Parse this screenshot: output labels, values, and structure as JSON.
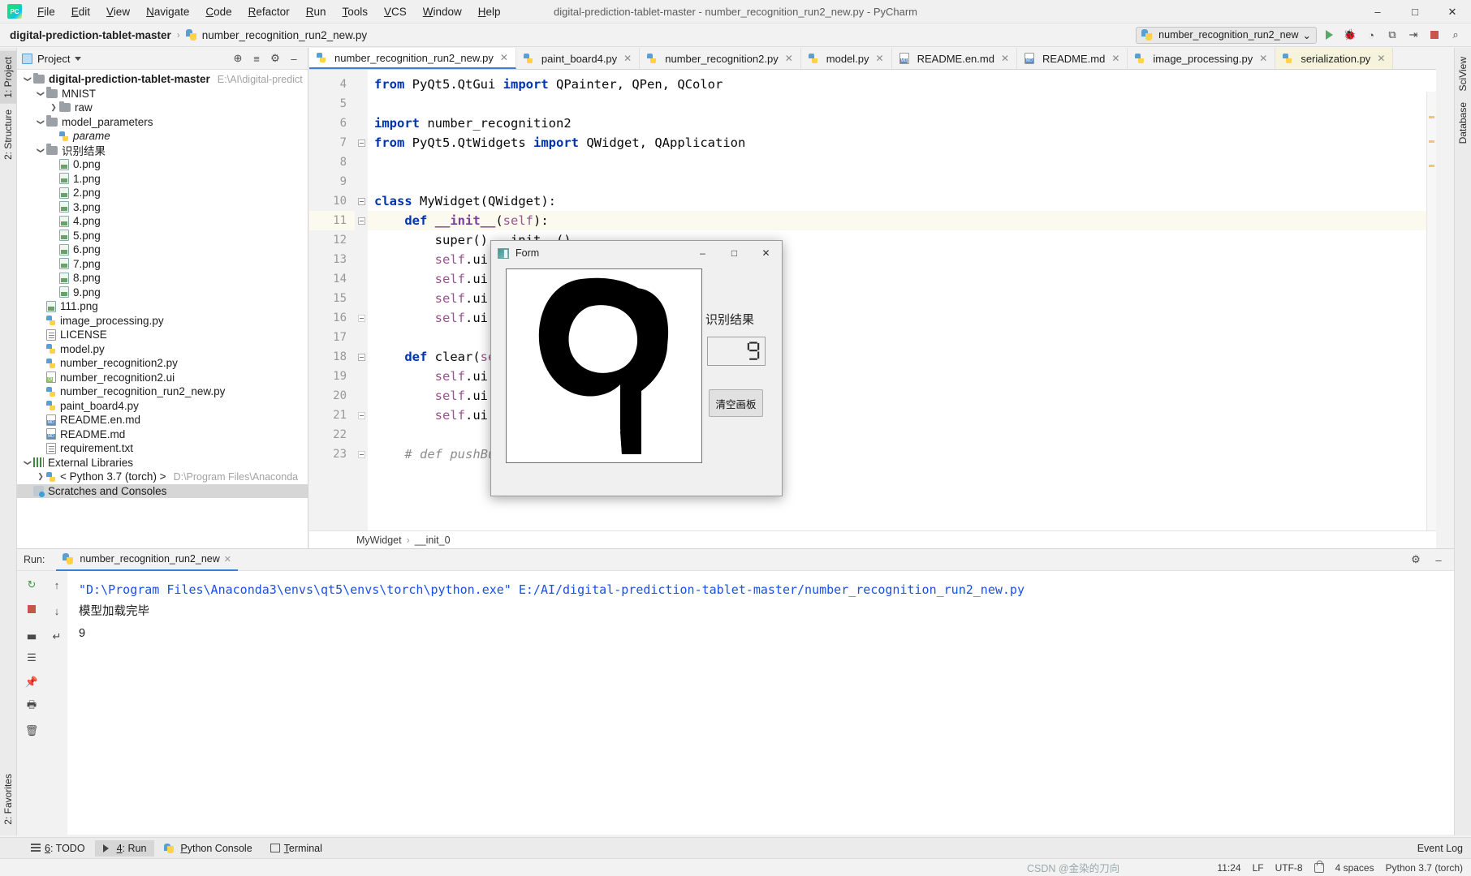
{
  "titlebar": {
    "window_title": "digital-prediction-tablet-master - number_recognition_run2_new.py - PyCharm",
    "menus": [
      "File",
      "Edit",
      "View",
      "Navigate",
      "Code",
      "Refactor",
      "Run",
      "Tools",
      "VCS",
      "Window",
      "Help"
    ],
    "minimize": "–",
    "maximize": "□",
    "close": "✕"
  },
  "navbar": {
    "breadcrumb_project": "digital-prediction-tablet-master",
    "breadcrumb_sep": "›",
    "breadcrumb_file": "number_recognition_run2_new.py",
    "run_config": "number_recognition_run2_new",
    "run_config_caret": "⌄",
    "icons": {
      "build": "↻",
      "debug": "🐞",
      "coverage": "◔",
      "profile": "⧉",
      "attach": "⇥",
      "stop": "stop-icon",
      "search": "⌕"
    }
  },
  "left_strip": {
    "tabs_top": [
      "1: Project",
      "2: Structure"
    ],
    "tabs_bottom": [
      "2: Favorites"
    ]
  },
  "right_strip": {
    "tabs_top": [
      "SciView",
      "Database"
    ]
  },
  "project_panel": {
    "title": "Project",
    "tools": {
      "locate": "⊕",
      "collapse": "≡",
      "settings": "⚙",
      "hide": "–"
    },
    "tree": [
      {
        "indent": 0,
        "arrow": "⌄",
        "icon": "folder",
        "label": "digital-prediction-tablet-master",
        "bold": true,
        "path": "E:\\AI\\digital-predict"
      },
      {
        "indent": 1,
        "arrow": "⌄",
        "icon": "folder",
        "label": "MNIST"
      },
      {
        "indent": 2,
        "arrow": "›",
        "icon": "folder",
        "label": "raw"
      },
      {
        "indent": 1,
        "arrow": "⌄",
        "icon": "folder",
        "label": "model_parameters"
      },
      {
        "indent": 2,
        "arrow": "",
        "icon": "py",
        "label": "parame",
        "italic": true
      },
      {
        "indent": 1,
        "arrow": "⌄",
        "icon": "folder",
        "label": "识别结果"
      },
      {
        "indent": 2,
        "arrow": "",
        "icon": "img",
        "label": "0.png"
      },
      {
        "indent": 2,
        "arrow": "",
        "icon": "img",
        "label": "1.png"
      },
      {
        "indent": 2,
        "arrow": "",
        "icon": "img",
        "label": "2.png"
      },
      {
        "indent": 2,
        "arrow": "",
        "icon": "img",
        "label": "3.png"
      },
      {
        "indent": 2,
        "arrow": "",
        "icon": "img",
        "label": "4.png"
      },
      {
        "indent": 2,
        "arrow": "",
        "icon": "img",
        "label": "5.png"
      },
      {
        "indent": 2,
        "arrow": "",
        "icon": "img",
        "label": "6.png"
      },
      {
        "indent": 2,
        "arrow": "",
        "icon": "img",
        "label": "7.png"
      },
      {
        "indent": 2,
        "arrow": "",
        "icon": "img",
        "label": "8.png"
      },
      {
        "indent": 2,
        "arrow": "",
        "icon": "img",
        "label": "9.png"
      },
      {
        "indent": 1,
        "arrow": "",
        "icon": "img",
        "label": "111.png"
      },
      {
        "indent": 1,
        "arrow": "",
        "icon": "py",
        "label": "image_processing.py"
      },
      {
        "indent": 1,
        "arrow": "",
        "icon": "txt",
        "label": "LICENSE"
      },
      {
        "indent": 1,
        "arrow": "",
        "icon": "py",
        "label": "model.py"
      },
      {
        "indent": 1,
        "arrow": "",
        "icon": "py",
        "label": "number_recognition2.py"
      },
      {
        "indent": 1,
        "arrow": "",
        "icon": "qt",
        "label": "number_recognition2.ui"
      },
      {
        "indent": 1,
        "arrow": "",
        "icon": "py",
        "label": "number_recognition_run2_new.py"
      },
      {
        "indent": 1,
        "arrow": "",
        "icon": "py",
        "label": "paint_board4.py"
      },
      {
        "indent": 1,
        "arrow": "",
        "icon": "md",
        "label": "README.en.md"
      },
      {
        "indent": 1,
        "arrow": "",
        "icon": "md",
        "label": "README.md"
      },
      {
        "indent": 1,
        "arrow": "",
        "icon": "txt",
        "label": "requirement.txt"
      },
      {
        "indent": 0,
        "arrow": "⌄",
        "icon": "libs",
        "label": "External Libraries"
      },
      {
        "indent": 1,
        "arrow": "›",
        "icon": "py",
        "label": "< Python 3.7 (torch) >",
        "path": "D:\\Program Files\\Anaconda"
      },
      {
        "indent": 0,
        "arrow": "",
        "icon": "scratch",
        "label": "Scratches and Consoles",
        "selected": true
      }
    ]
  },
  "editor": {
    "tabs": [
      {
        "label": "number_recognition_run2_new.py",
        "icon": "py",
        "active": true,
        "close": "✕"
      },
      {
        "label": "paint_board4.py",
        "icon": "py",
        "active": false,
        "close": "✕"
      },
      {
        "label": "number_recognition2.py",
        "icon": "py",
        "active": false,
        "close": "✕"
      },
      {
        "label": "model.py",
        "icon": "py",
        "active": false,
        "close": "✕"
      },
      {
        "label": "README.en.md",
        "icon": "md",
        "active": false,
        "close": "✕"
      },
      {
        "label": "README.md",
        "icon": "md",
        "active": false,
        "close": "✕"
      },
      {
        "label": "image_processing.py",
        "icon": "py",
        "active": false,
        "close": "✕"
      },
      {
        "label": "serialization.py",
        "icon": "py",
        "active": false,
        "close": "✕",
        "highlight": true
      }
    ],
    "lines": [
      {
        "n": 4,
        "html": "<span class='kw'>from</span> <span class='plain'>PyQt5.QtGui</span> <span class='kw'>import</span> <span class='plain'>QPainter, QPen, QColor</span>"
      },
      {
        "n": 5,
        "html": ""
      },
      {
        "n": 6,
        "html": "<span class='kw'>import</span> <span class='plain'>number_recognition2</span>"
      },
      {
        "n": 7,
        "html": "<span class='kw'>from</span> <span class='plain'>PyQt5.QtWidgets</span> <span class='kw'>import</span> <span class='plain'>QWidget, QApplication</span>",
        "fold": true
      },
      {
        "n": 8,
        "html": ""
      },
      {
        "n": 9,
        "html": ""
      },
      {
        "n": 10,
        "html": "<span class='kw'>class</span> <span class='plain'>MyWidget(QWidget):</span>",
        "fold": true
      },
      {
        "n": 11,
        "html": "    <span class='kw'>def</span> <span class='fn'>__init__</span><span class='plain'>(</span><span class='self'>self</span><span class='plain'>):</span>",
        "fold": true,
        "current": true
      },
      {
        "n": 12,
        "html": "        <span class='plain'>super().__init__()</span>"
      },
      {
        "n": 13,
        "html": "        <span class='self'>self</span><span class='plain'>.ui = numb</span>"
      },
      {
        "n": 14,
        "html": "        <span class='self'>self</span><span class='plain'>.ui.setupU</span>"
      },
      {
        "n": 15,
        "html": "        <span class='self'>self</span><span class='plain'>.ui.pushBu</span>"
      },
      {
        "n": 16,
        "html": "        <span class='self'>self</span><span class='plain'>.ui.lcdNum</span>",
        "fold": true,
        "foldlight": true
      },
      {
        "n": 17,
        "html": ""
      },
      {
        "n": 18,
        "html": "    <span class='kw'>def</span> <span class='plain'>clear(</span><span class='self'>self</span><span class='plain'>):</span>",
        "fold": true
      },
      {
        "n": 19,
        "html": "        <span class='self'>self</span><span class='plain'>.ui.widget</span>"
      },
      {
        "n": 20,
        "html": "        <span class='self'>self</span><span class='plain'>.ui.lcdNum</span>"
      },
      {
        "n": 21,
        "html": "        <span class='self'>self</span><span class='plain'>.ui.widget</span>",
        "fold": true,
        "foldlight": true
      },
      {
        "n": 22,
        "html": ""
      },
      {
        "n": 23,
        "html": "    <span class='cmt'># def pushButton_c</span>",
        "fold": true,
        "foldlight": true
      }
    ],
    "breadcrumb": [
      "MyWidget",
      "__init_0"
    ],
    "breadcrumb_sep": "›"
  },
  "qt_form": {
    "title": "Form",
    "minimize": "–",
    "maximize": "□",
    "close": "✕",
    "result_label": "识别结果",
    "lcd_value": "9",
    "clear_button": "清空画板"
  },
  "run_window": {
    "label": "Run:",
    "tab_name": "number_recognition_run2_new",
    "tab_close": "✕",
    "settings_icon": "⚙",
    "hide_icon": "–",
    "gutter_icons": [
      "↻",
      "■",
      "▃",
      "☰",
      "📌",
      "🖶",
      "🗑"
    ],
    "gutter2_icons": [
      "↑",
      "↓",
      "↵"
    ],
    "console": [
      {
        "text": "\"D:\\Program Files\\Anaconda3\\envs\\qt5\\envs\\torch\\python.exe\" E:/AI/digital-prediction-tablet-master/number_recognition_run2_new.py",
        "style": "cmd"
      },
      {
        "text": "模型加载完毕",
        "style": "out"
      },
      {
        "text": "9",
        "style": "out"
      }
    ]
  },
  "bottom_bar": {
    "items": [
      {
        "label": "6: TODO",
        "icon": "list-icon",
        "active": false
      },
      {
        "label": "4: Run",
        "icon": "run-icon",
        "active": true
      },
      {
        "label": "Python Console",
        "icon": "python-icon",
        "active": false
      },
      {
        "label": "Terminal",
        "icon": "terminal-icon",
        "active": false
      }
    ],
    "event_log": "Event Log"
  },
  "statusbar": {
    "watermark": "CSDN @金染的刀向",
    "time": "11:24",
    "line_sep": "LF",
    "encoding": "UTF-8",
    "indent": "4 spaces",
    "interpreter": "Python 3.7 (torch)",
    "lock_icon": "lock-icon"
  }
}
